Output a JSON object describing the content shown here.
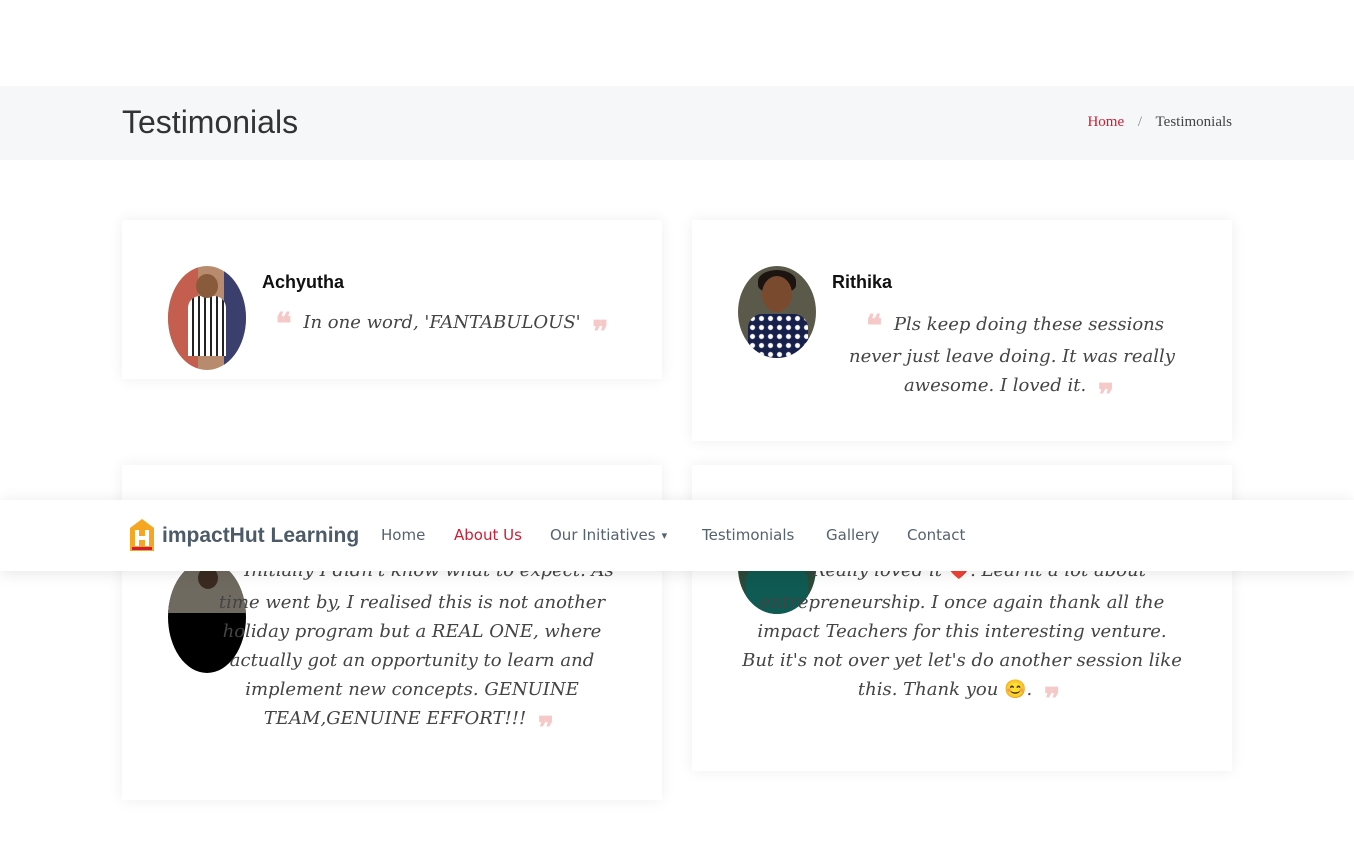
{
  "page": {
    "title": "Testimonials"
  },
  "breadcrumb": {
    "home": "Home",
    "separator": "/",
    "current": "Testimonials"
  },
  "navbar": {
    "brand": "impactHut Learning",
    "items": [
      {
        "label": "Home",
        "active": false
      },
      {
        "label": "About Us",
        "active": true
      },
      {
        "label": "Our Initiatives",
        "active": false,
        "has_dropdown": true
      },
      {
        "label": "Testimonials",
        "active": false
      },
      {
        "label": "Gallery",
        "active": false
      },
      {
        "label": "Contact",
        "active": false
      }
    ],
    "dropdown_icon": "chevron-down-icon"
  },
  "testimonials": [
    {
      "name": "Achyutha",
      "quote": "In one word, 'FANTABULOUS'"
    },
    {
      "name": "Rithika",
      "quote": "Pls keep doing these sessions never just leave doing. It was really awesome. I loved it."
    },
    {
      "name": "",
      "quote": "Initially I didn't know what to expect. As time went by, I realised this is not another holiday program but a REAL ONE, where actually got an opportunity to learn and implement new concepts. GENUINE TEAM,GENUINE EFFORT!!!"
    },
    {
      "name": "",
      "quote_start": "Really loved it",
      "emoji_heart": "❤️",
      "quote_middle": ". Learnt a lot about entrepreneurship. I once again thank all the impact Teachers for this interesting venture. But it's not over yet let's do another session like this. Thank you",
      "emoji_smile": "😊",
      "quote_end": "."
    }
  ],
  "quote_open": "❝",
  "quote_close": "❞",
  "colors": {
    "accent": "#d01d33",
    "breadcrumb_bg": "#f6f7f8",
    "quote_mark": "#f6c9c9",
    "nav_text": "#556270"
  }
}
